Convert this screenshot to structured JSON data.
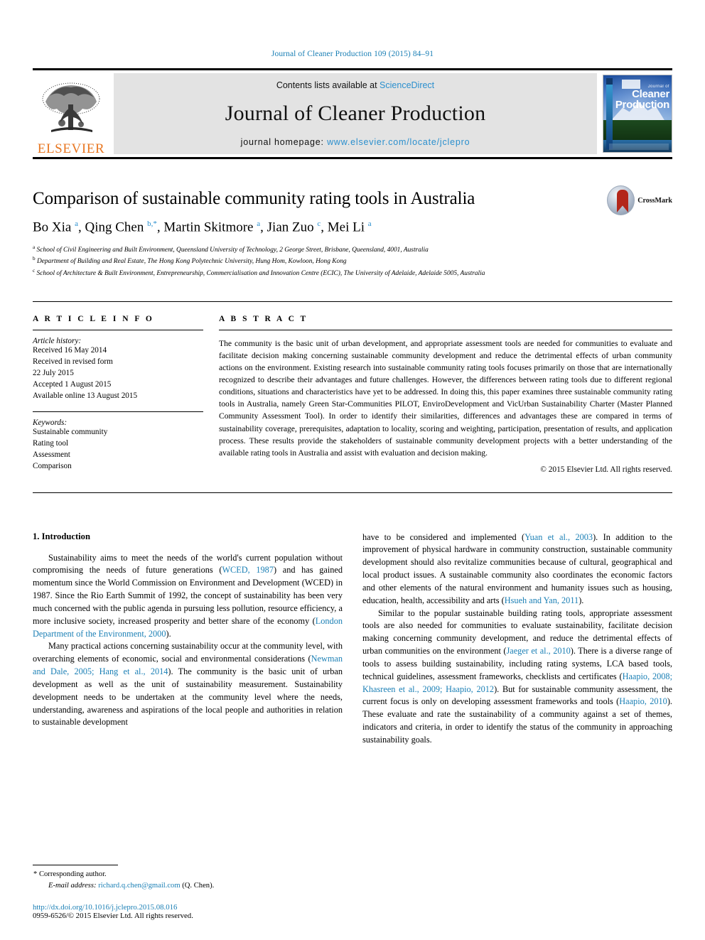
{
  "running_head": "Journal of Cleaner Production 109 (2015) 84–91",
  "masthead": {
    "publisher_name": "ELSEVIER",
    "contents_prefix": "Contents lists available at ",
    "contents_link": "ScienceDirect",
    "journal_name": "Journal of Cleaner Production",
    "homepage_prefix": "journal homepage: ",
    "homepage_url": "www.elsevier.com/locate/jclepro",
    "cover": {
      "kicker": "Journal of",
      "line1": "Cleaner",
      "line2": "Production"
    }
  },
  "article": {
    "title": "Comparison of sustainable community rating tools in Australia",
    "authors_html": "Bo Xia <sup>a</sup>, Qing Chen <sup>b,*</sup>, Martin Skitmore <sup>a</sup>, Jian Zuo <sup>c</sup>, Mei Li <sup>a</sup>",
    "affiliations": [
      {
        "marker": "a",
        "text": "School of Civil Engineering and Built Environment, Queensland University of Technology, 2 George Street, Brisbane, Queensland, 4001, Australia"
      },
      {
        "marker": "b",
        "text": "Department of Building and Real Estate, The Hong Kong Polytechnic University, Hung Hom, Kowloon, Hong Kong"
      },
      {
        "marker": "c",
        "text": "School of Architecture & Built Environment, Entrepreneurship, Commercialisation and Innovation Centre (ECIC), The University of Adelaide, Adelaide 5005, Australia"
      }
    ],
    "crossmark_label": "CrossMark"
  },
  "article_info": {
    "heading": "A R T I C L E   I N F O",
    "history_label": "Article history:",
    "history": [
      "Received 16 May 2014",
      "Received in revised form",
      "22 July 2015",
      "Accepted 1 August 2015",
      "Available online 13 August 2015"
    ],
    "keywords_label": "Keywords:",
    "keywords": [
      "Sustainable community",
      "Rating tool",
      "Assessment",
      "Comparison"
    ]
  },
  "abstract": {
    "heading": "A B S T R A C T",
    "text": "The community is the basic unit of urban development, and appropriate assessment tools are needed for communities to evaluate and facilitate decision making concerning sustainable community development and reduce the detrimental effects of urban community actions on the environment. Existing research into sustainable community rating tools focuses primarily on those that are internationally recognized to describe their advantages and future challenges. However, the differences between rating tools due to different regional conditions, situations and characteristics have yet to be addressed. In doing this, this paper examines three sustainable community rating tools in Australia, namely Green Star-Communities PILOT, EnviroDevelopment and VicUrban Sustainability Charter (Master Planned Community Assessment Tool). In order to identify their similarities, differences and advantages these are compared in terms of sustainability coverage, prerequisites, adaptation to locality, scoring and weighting, participation, presentation of results, and application process. These results provide the stakeholders of sustainable community development projects with a better understanding of the available rating tools in Australia and assist with evaluation and decision making.",
    "copyright": "© 2015 Elsevier Ltd. All rights reserved."
  },
  "introduction": {
    "heading": "1. Introduction",
    "left_paragraphs": [
      "Sustainability aims to meet the needs of the world's current population without compromising the needs of future generations (<span class=\"ref\">WCED, 1987</span>) and has gained momentum since the World Commission on Environment and Development (WCED) in 1987. Since the Rio Earth Summit of 1992, the concept of sustainability has been very much concerned with the public agenda in pursuing less pollution, resource efficiency, a more inclusive society, increased prosperity and better share of the economy (<span class=\"ref\">London Department of the Environment, 2000</span>).",
      "Many practical actions concerning sustainability occur at the community level, with overarching elements of economic, social and environmental considerations (<span class=\"ref\">Newman and Dale, 2005; Hang et al., 2014</span>). The community is the basic unit of urban development as well as the unit of sustainability measurement. Sustainability development needs to be undertaken at the community level where the needs, understanding, awareness and aspirations of the local people and authorities in relation to sustainable development"
    ],
    "right_paragraphs": [
      "have to be considered and implemented (<span class=\"ref\">Yuan et al., 2003</span>). In addition to the improvement of physical hardware in community construction, sustainable community development should also revitalize communities because of cultural, geographical and local product issues. A sustainable community also coordinates the economic factors and other elements of the natural environment and humanity issues such as housing, education, health, accessibility and arts (<span class=\"ref\">Hsueh and Yan, 2011</span>).",
      "Similar to the popular sustainable building rating tools, appropriate assessment tools are also needed for communities to evaluate sustainability, facilitate decision making concerning community development, and reduce the detrimental effects of urban communities on the environment (<span class=\"ref\">Jaeger et al., 2010</span>). There is a diverse range of tools to assess building sustainability, including rating systems, LCA based tools, technical guidelines, assessment frameworks, checklists and certificates (<span class=\"ref\">Haapio, 2008; Khasreen et al., 2009; Haapio, 2012</span>). But for sustainable community assessment, the current focus is only on developing assessment frameworks and tools (<span class=\"ref\">Haapio, 2010</span>). These evaluate and rate the sustainability of a community against a set of themes, indicators and criteria, in order to identify the status of the community in approaching sustainability goals."
    ],
    "right_first_is_continuation": true
  },
  "footer": {
    "corresponding_author": "* Corresponding author.",
    "email_label": "E-mail address:",
    "email": "richard.q.chen@gmail.com",
    "email_suffix": " (Q. Chen).",
    "doi": "http://dx.doi.org/10.1016/j.jclepro.2015.08.016",
    "issn": "0959-6526/© 2015 Elsevier Ltd. All rights reserved."
  },
  "colors": {
    "link": "#1a7fb5",
    "elsevier_orange": "#E87722",
    "masthead_bg": "#e3e3e3"
  }
}
